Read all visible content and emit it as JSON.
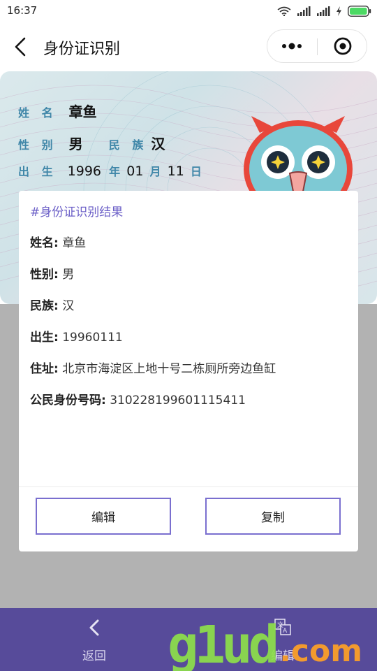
{
  "status_bar": {
    "time": "16:37"
  },
  "nav": {
    "title": "身份证识别"
  },
  "id_card": {
    "name_label": "姓 名",
    "name_value": "章鱼",
    "sex_label": "性 别",
    "sex_value": "男",
    "ethnic_label": "民 族",
    "ethnic_value": "汉",
    "birth_label": "出 生",
    "birth_year": "1996",
    "year_unit": "年",
    "birth_month": "01",
    "month_unit": "月",
    "birth_day": "11",
    "day_unit": "日"
  },
  "result": {
    "title": "#身份证识别结果",
    "rows": [
      {
        "label": "姓名:",
        "value": "章鱼"
      },
      {
        "label": "性别:",
        "value": "男"
      },
      {
        "label": "民族:",
        "value": "汉"
      },
      {
        "label": "出生:",
        "value": "19960111"
      },
      {
        "label": "住址:",
        "value": "北京市海淀区上地十号二栋厕所旁边鱼缸"
      },
      {
        "label": "公民身份号码:",
        "value": "310228199601115411"
      }
    ],
    "edit_button": "编辑",
    "copy_button": "复制"
  },
  "bottom_bar": {
    "back_label": "返回",
    "edit_label": "编辑"
  },
  "watermark": {
    "main": "g1ud",
    "domain": ".com"
  },
  "colors": {
    "accent": "#574b9a",
    "dialog_title": "#6b5fc7",
    "button_border": "#7a6fcf",
    "mask": "#b2b2b2"
  },
  "icons": {
    "back": "chevron-left-icon",
    "more": "more-dots-icon",
    "close": "target-circle-icon",
    "translate": "translate-icon",
    "wifi": "wifi-icon",
    "signal": "signal-icon",
    "charge": "charge-icon",
    "battery": "battery-icon"
  }
}
